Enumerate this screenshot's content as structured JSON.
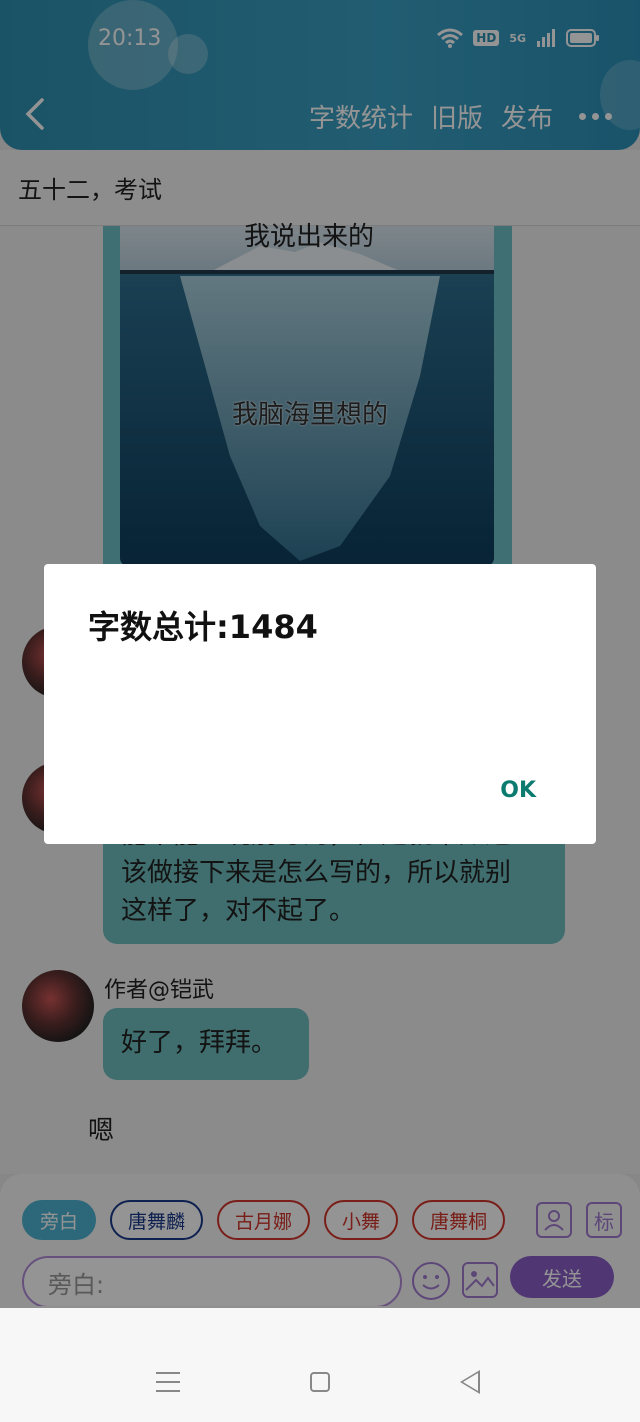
{
  "status_bar": {
    "time": "20:13",
    "hd_label": "HD",
    "network_label": "5G"
  },
  "header": {
    "actions": [
      "字数统计",
      "旧版",
      "发布"
    ]
  },
  "chapter": {
    "title": "五十二，考试"
  },
  "meme": {
    "top_text": "我说出来的",
    "mid_text": "我脑海里想的"
  },
  "messages": [
    {
      "text_lines": [
        "能不能一说别写的，但是就不知道",
        "该做接下来是怎么写的，所以就别",
        "这样了，对不起了。"
      ]
    },
    {
      "author": "作者@铠武",
      "text": "好了，拜拜。"
    }
  ],
  "narration": "嗯",
  "input_area": {
    "chips": [
      {
        "label": "旁白",
        "style": "active"
      },
      {
        "label": "唐舞麟",
        "style": "blue"
      },
      {
        "label": "古月娜",
        "style": "red"
      },
      {
        "label": "小舞",
        "style": "red"
      },
      {
        "label": "唐舞桐",
        "style": "red"
      }
    ],
    "tag_label": "标",
    "placeholder": "旁白:",
    "send_label": "发送"
  },
  "dialog": {
    "message": "字数总计:1484",
    "ok_label": "OK"
  },
  "colors": {
    "header": "#3aa0c4",
    "bubble": "#6fbdbe",
    "accent_purple": "#8a5fc8",
    "ok_text": "#0b7b70"
  }
}
